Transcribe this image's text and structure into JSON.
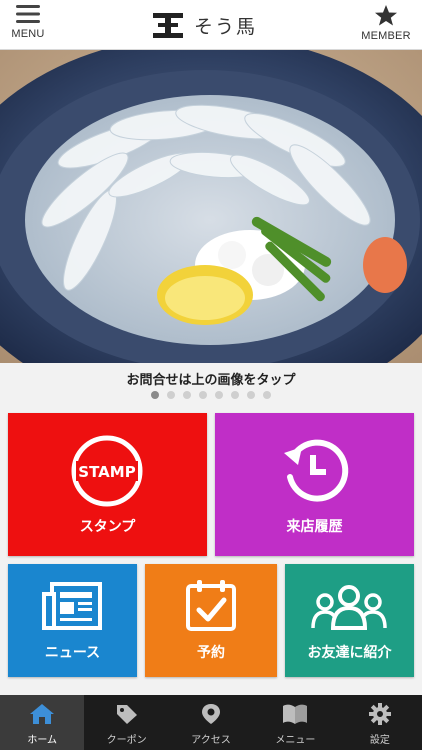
{
  "header": {
    "menu_label": "MENU",
    "app_name": "そう馬",
    "logo_mark": "王",
    "member_label": "MEMBER"
  },
  "hero": {
    "caption": "お問合せは上の画像をタップ",
    "slide_count": 8,
    "active_slide": 1
  },
  "tiles": {
    "stamp": {
      "label": "スタンプ",
      "badge": "STAMP",
      "color": "#ee1010"
    },
    "history": {
      "label": "来店履歴",
      "color": "#c02ec7"
    },
    "news": {
      "label": "ニュース",
      "color": "#1a86cf"
    },
    "reserve": {
      "label": "予約",
      "color": "#f07d17"
    },
    "friend": {
      "label": "お友達に紹介",
      "color": "#1e9e85"
    }
  },
  "tabbar": {
    "items": [
      {
        "label": "ホーム",
        "icon": "home-icon",
        "active": true
      },
      {
        "label": "クーポン",
        "icon": "tag-icon",
        "active": false
      },
      {
        "label": "アクセス",
        "icon": "map-pin-icon",
        "active": false
      },
      {
        "label": "メニュー",
        "icon": "book-icon",
        "active": false
      },
      {
        "label": "設定",
        "icon": "gear-icon",
        "active": false
      }
    ]
  }
}
